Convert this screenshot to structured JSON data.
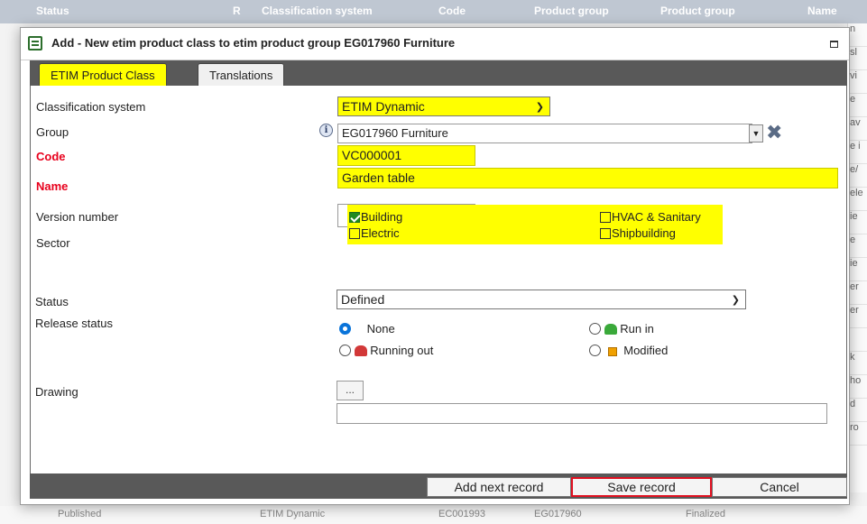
{
  "background": {
    "header_cols": [
      "Status",
      "R",
      "Classification system",
      "Code",
      "Product group",
      "Product group",
      "Name"
    ],
    "right_col_fragments": [
      "n",
      "sl",
      "vi",
      "e",
      "av",
      "e i",
      "e/",
      "ele",
      "ie",
      "e",
      "ie",
      "er",
      "er",
      "",
      "k",
      "ho",
      "d",
      "ro"
    ],
    "footer_fragments": [
      "Published",
      "ETIM Dynamic",
      "EC001993",
      "EG017960",
      "Finalized"
    ]
  },
  "dialog": {
    "title": "Add - New etim product class to etim product group EG017960 Furniture",
    "tabs": [
      {
        "label": "ETIM Product Class",
        "active": true
      },
      {
        "label": "Translations",
        "active": false
      }
    ],
    "fields": {
      "classification_system": {
        "label": "Classification system",
        "value": "ETIM Dynamic"
      },
      "group": {
        "label": "Group",
        "value": "EG017960 Furniture"
      },
      "code": {
        "label": "Code",
        "value": "VC000001"
      },
      "name": {
        "label": "Name",
        "value": "Garden table"
      },
      "version_number": {
        "label": "Version number",
        "value": ""
      },
      "sector": {
        "label": "Sector",
        "options": [
          {
            "label": "Building",
            "checked": true
          },
          {
            "label": "HVAC & Sanitary",
            "checked": false
          },
          {
            "label": "Electric",
            "checked": false
          },
          {
            "label": "Shipbuilding",
            "checked": false
          }
        ]
      },
      "status": {
        "label": "Status",
        "value": "Defined"
      },
      "release_status": {
        "label": "Release status",
        "options": [
          {
            "label": "None",
            "selected": true,
            "icon": "none"
          },
          {
            "label": "Run in",
            "selected": false,
            "icon": "green-flag-icon"
          },
          {
            "label": "Running out",
            "selected": false,
            "icon": "red-flag-icon"
          },
          {
            "label": "Modified",
            "selected": false,
            "icon": "orange-square-icon"
          }
        ]
      },
      "drawing": {
        "label": "Drawing",
        "browse_label": "...",
        "value": ""
      }
    },
    "buttons": {
      "add_next": "Add next record",
      "save": "Save record",
      "cancel": "Cancel"
    }
  },
  "colors": {
    "highlight_yellow": "#ffff00",
    "required_red": "#e8001c",
    "bar_gray": "#595959",
    "save_border": "#e01020"
  }
}
